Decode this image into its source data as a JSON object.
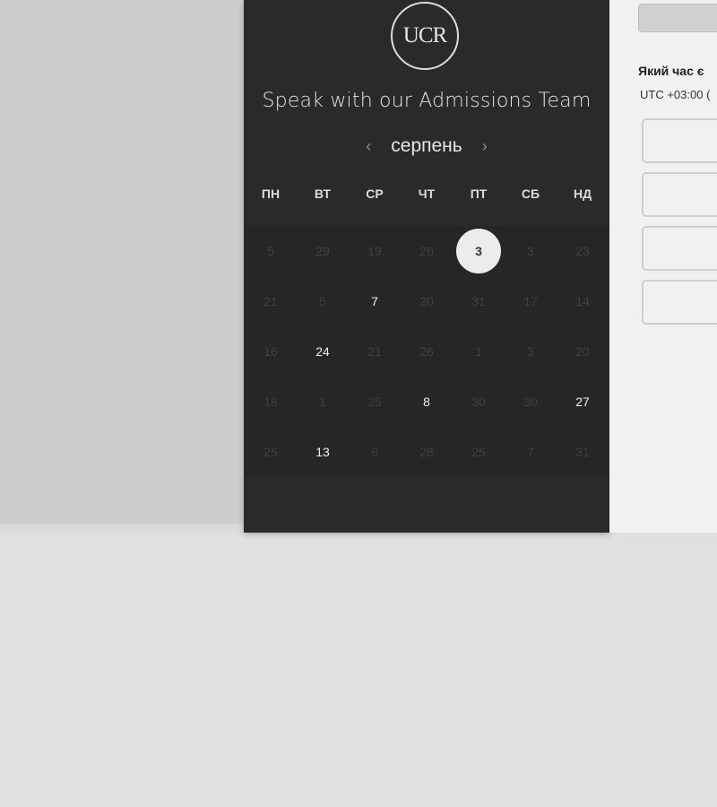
{
  "card": {
    "logo_text": "UCR",
    "title": "Speak with our Admissions Team",
    "month": "серпень",
    "prev_icon": "‹",
    "next_icon": "›"
  },
  "weekdays": [
    "ПН",
    "ВТ",
    "СР",
    "ЧТ",
    "ПТ",
    "СБ",
    "НД"
  ],
  "calendar": {
    "rows": [
      [
        {
          "label": "5",
          "available": false
        },
        {
          "label": "29",
          "available": false
        },
        {
          "label": "19",
          "available": false
        },
        {
          "label": "26",
          "available": false
        },
        {
          "label": "3",
          "available": true,
          "selected": true
        },
        {
          "label": "3",
          "available": false
        },
        {
          "label": "23",
          "available": false
        }
      ],
      [
        {
          "label": "21",
          "available": false
        },
        {
          "label": "5",
          "available": false
        },
        {
          "label": "7",
          "available": true
        },
        {
          "label": "20",
          "available": false
        },
        {
          "label": "31",
          "available": false
        },
        {
          "label": "17",
          "available": false
        },
        {
          "label": "14",
          "available": false
        }
      ],
      [
        {
          "label": "16",
          "available": false
        },
        {
          "label": "24",
          "available": true
        },
        {
          "label": "21",
          "available": false
        },
        {
          "label": "26",
          "available": false
        },
        {
          "label": "1",
          "available": false
        },
        {
          "label": "3",
          "available": false
        },
        {
          "label": "20",
          "available": false
        }
      ],
      [
        {
          "label": "18",
          "available": false
        },
        {
          "label": "1",
          "available": false
        },
        {
          "label": "25",
          "available": false
        },
        {
          "label": "8",
          "available": true
        },
        {
          "label": "30",
          "available": false
        },
        {
          "label": "30",
          "available": false
        },
        {
          "label": "27",
          "available": true
        }
      ],
      [
        {
          "label": "25",
          "available": false
        },
        {
          "label": "13",
          "available": true
        },
        {
          "label": "6",
          "available": false
        },
        {
          "label": "28",
          "available": false
        },
        {
          "label": "25",
          "available": false
        },
        {
          "label": "7",
          "available": false
        },
        {
          "label": "31",
          "available": false
        }
      ]
    ]
  },
  "right_panel": {
    "timezone_question": "Який час є",
    "timezone_value": "UTC +03:00 (",
    "time_slot_count": 4
  },
  "colors": {
    "card_bg": "#2a2a2a",
    "selected_day_bg": "#ececec",
    "available_day": "#f0f0f0",
    "unavailable_day": "#3f3f3f"
  }
}
